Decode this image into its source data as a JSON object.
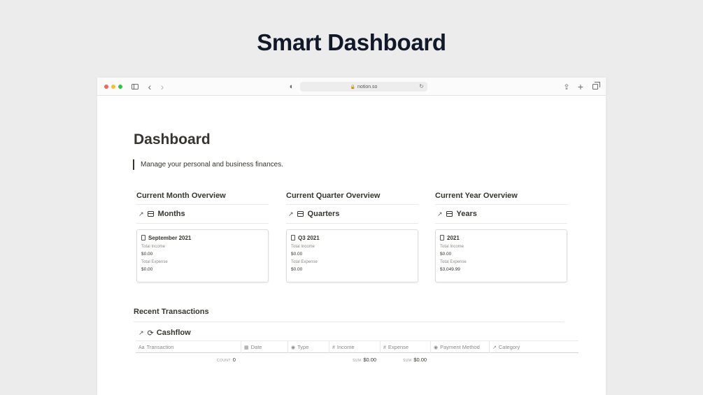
{
  "hero": {
    "title": "Smart Dashboard"
  },
  "browser": {
    "url": "notion.so"
  },
  "page": {
    "title": "Dashboard",
    "quote": "Manage your personal and business finances."
  },
  "overviews": [
    {
      "heading": "Current Month Overview",
      "view": "Months",
      "card_title": "September 2021",
      "income_label": "Total Income",
      "income": "$0.00",
      "expense_label": "Total Expense",
      "expense": "$0.00"
    },
    {
      "heading": "Current Quarter Overview",
      "view": "Quarters",
      "card_title": "Q3 2021",
      "income_label": "Total Income",
      "income": "$0.00",
      "expense_label": "Total Expense",
      "expense": "$0.00"
    },
    {
      "heading": "Current Year Overview",
      "view": "Years",
      "card_title": "2021",
      "income_label": "Total Income",
      "income": "$0.00",
      "expense_label": "Total Expense",
      "expense": "$3,049.99"
    }
  ],
  "transactions": {
    "heading": "Recent Transactions",
    "view": "Cashflow",
    "columns": [
      {
        "label": "Transaction",
        "icon": "text-icon"
      },
      {
        "label": "Date",
        "icon": "calendar-icon"
      },
      {
        "label": "Type",
        "icon": "select-icon"
      },
      {
        "label": "Income",
        "icon": "number-icon"
      },
      {
        "label": "Expense",
        "icon": "number-icon"
      },
      {
        "label": "Payment Method",
        "icon": "select-icon"
      },
      {
        "label": "Category",
        "icon": "relation-arrow-icon"
      }
    ],
    "count_label": "COUNT",
    "count_value": "0",
    "income_sum_label": "SUM",
    "income_sum": "$0.00",
    "expense_sum_label": "SUM",
    "expense_sum": "$0.00"
  }
}
